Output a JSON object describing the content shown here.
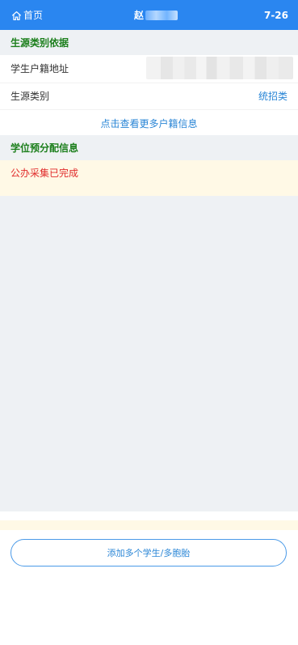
{
  "header": {
    "home_label": "首页",
    "title": "赵",
    "time": "7-26"
  },
  "sections": {
    "source_basis": {
      "title": "生源类别依据",
      "address_label": "学生户籍地址",
      "category_label": "生源类别",
      "category_value": "统招类",
      "more_link": "点击查看更多户籍信息"
    },
    "degree_preallocation": {
      "title": "学位预分配信息",
      "status": "公办采集已完成"
    }
  },
  "footer": {
    "add_button_label": "添加多个学生/多胞胎"
  },
  "colors": {
    "primary": "#2a86f0",
    "section_text": "#1c7f1c",
    "status_text": "#e02b2b",
    "link": "#2a86d6",
    "status_background": "#fff9e6",
    "section_background": "#eef1f4"
  },
  "icons": {
    "home": "home-icon"
  }
}
